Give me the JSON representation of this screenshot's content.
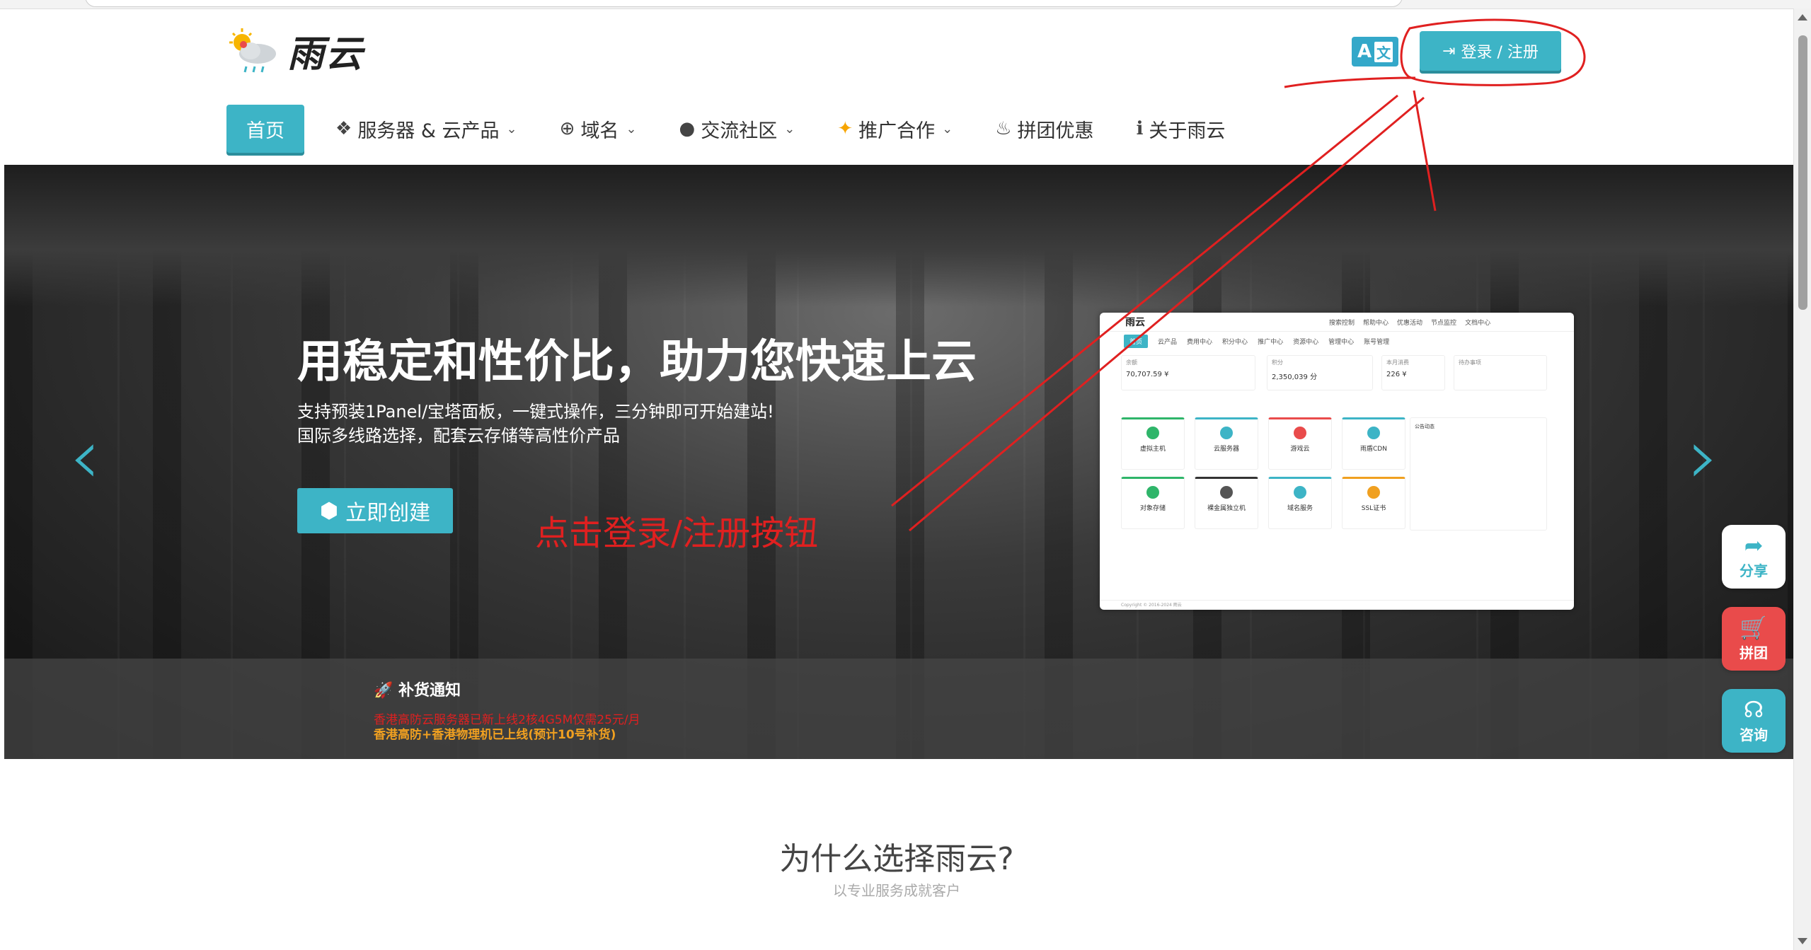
{
  "brand": {
    "logo_text": "雨云",
    "logo_icon": "sun-cloud-rain-icon"
  },
  "header": {
    "lang_button": {
      "latin": "A",
      "chinese": "文",
      "icon": "translate-icon"
    },
    "login_button": {
      "label": "登录 / 注册",
      "icon": "sign-in-icon"
    }
  },
  "nav": {
    "items": [
      {
        "label": "首页",
        "active": true
      },
      {
        "label": "服务器 & 云产品",
        "icon": "cubes-icon",
        "dropdown": true
      },
      {
        "label": "域名",
        "icon": "globe-icon",
        "dropdown": true
      },
      {
        "label": "交流社区",
        "icon": "comment-icon",
        "dropdown": true
      },
      {
        "label": "推广合作",
        "icon": "sparkle-icon",
        "dropdown": true
      },
      {
        "label": "拼团优惠",
        "icon": "fire-icon"
      },
      {
        "label": "关于雨云",
        "icon": "info-icon"
      }
    ]
  },
  "hero": {
    "title": "用稳定和性价比，助力您快速上云",
    "subtitle_line1": "支持预装1Panel/宝塔面板，一键式操作，三分钟即可开始建站!",
    "subtitle_line2": "国际多线路选择，配套云存储等高性价产品",
    "cta_label": "立即创建",
    "cta_icon": "cube-icon",
    "prev_glyph": "‹",
    "next_glyph": "›"
  },
  "preview": {
    "logo": "雨云",
    "top_links": [
      "搜索控制",
      "帮助中心",
      "优惠活动",
      "节点监控",
      "文档中心"
    ],
    "nav": [
      "首页",
      "云产品",
      "费用中心",
      "积分中心",
      "推广中心",
      "资源中心",
      "管理中心",
      "账号管理"
    ],
    "cards": [
      {
        "label": "余额",
        "value": "70,707.59 ¥"
      },
      {
        "label": "积分",
        "value": "2,350,039 分"
      },
      {
        "label": "本月消费",
        "value": "226 ¥"
      },
      {
        "label": "待办事项",
        "value": ""
      }
    ],
    "tiles": [
      "虚拟主机",
      "云服务器",
      "游戏云",
      "雨盾CDN",
      "对象存储",
      "裸金属独立机",
      "域名服务",
      "SSL证书"
    ],
    "side_title": "公告动态",
    "footer": "Copyright © 2016-2024 雨云"
  },
  "notice": {
    "title": "🚀 补货通知",
    "line_red": "香港高防云服务器已新上线2核4G5M仅需25元/月",
    "line_orange": "香港高防+香港物理机已上线(预计10号补货)"
  },
  "annotation": {
    "text": "点击登录/注册按钮",
    "color": "#e02020"
  },
  "floating": [
    {
      "label": "分享",
      "icon": "share-icon"
    },
    {
      "label": "拼团",
      "icon": "cart-icon"
    },
    {
      "label": "咨询",
      "icon": "headset-icon"
    }
  ],
  "why": {
    "title": "为什么选择雨云?",
    "subtitle": "以专业服务成就客户"
  },
  "colors": {
    "accent": "#3db4c6",
    "danger": "#e94b4b",
    "annotation": "#e02020"
  }
}
